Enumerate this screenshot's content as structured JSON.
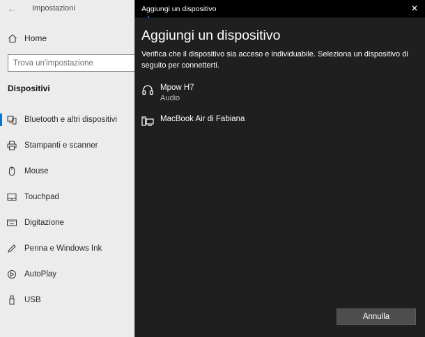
{
  "settings": {
    "app_title": "Impostazioni",
    "home_label": "Home",
    "search_placeholder": "Trova un'impostazione",
    "section_title": "Dispositivi",
    "nav_items": [
      {
        "label": "Bluetooth e altri dispositivi",
        "icon": "bluetooth-devices-icon",
        "selected": true
      },
      {
        "label": "Stampanti e scanner",
        "icon": "printer-icon"
      },
      {
        "label": "Mouse",
        "icon": "mouse-icon"
      },
      {
        "label": "Touchpad",
        "icon": "touchpad-icon"
      },
      {
        "label": "Digitazione",
        "icon": "keyboard-icon"
      },
      {
        "label": "Penna e Windows Ink",
        "icon": "pen-icon"
      },
      {
        "label": "AutoPlay",
        "icon": "autoplay-icon"
      },
      {
        "label": "USB",
        "icon": "usb-icon"
      }
    ],
    "accent_color": "#0078d7"
  },
  "dialog": {
    "window_title": "Aggiungi un dispositivo",
    "heading": "Aggiungi un dispositivo",
    "description": "Verifica che il dispositivo sia acceso e individuabile. Seleziona un dispositivo di seguito per connetterti.",
    "devices": [
      {
        "name": "Mpow H7",
        "type": "Audio",
        "icon": "headphones-icon"
      },
      {
        "name": "MacBook Air di Fabiana",
        "type": "",
        "icon": "computer-icon"
      }
    ],
    "cancel_label": "Annulla",
    "background_color": "#1f1f1f"
  }
}
